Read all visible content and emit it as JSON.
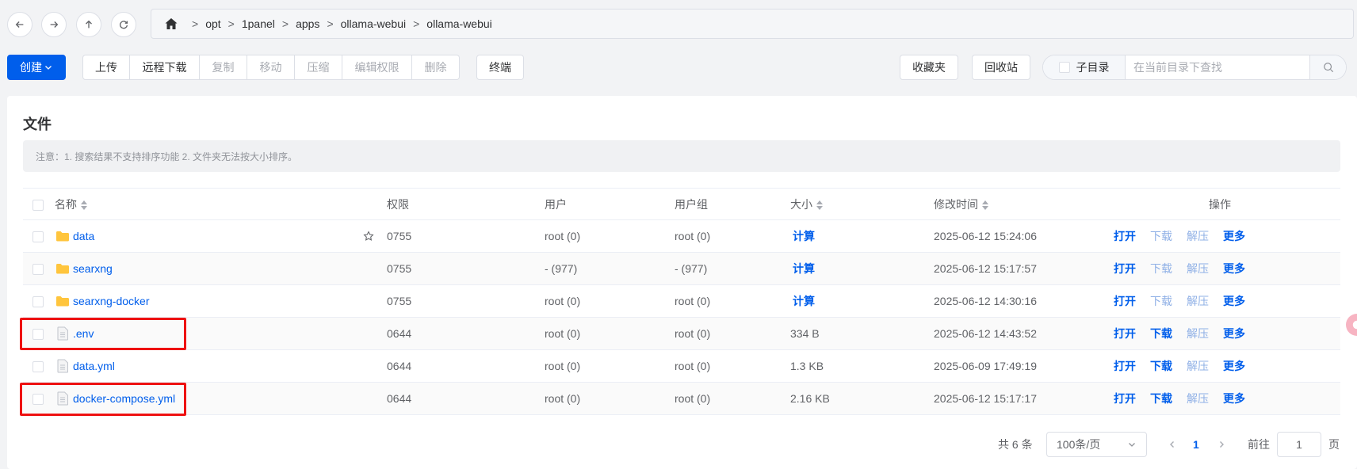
{
  "nav": {
    "breadcrumb": [
      "opt",
      "1panel",
      "apps",
      "ollama-webui",
      "ollama-webui"
    ],
    "separator": ">"
  },
  "toolbar": {
    "create_label": "创建",
    "group_buttons": [
      {
        "label": "上传",
        "disabled": false
      },
      {
        "label": "远程下载",
        "disabled": false
      },
      {
        "label": "复制",
        "disabled": true
      },
      {
        "label": "移动",
        "disabled": true
      },
      {
        "label": "压缩",
        "disabled": true
      },
      {
        "label": "编辑权限",
        "disabled": true
      },
      {
        "label": "删除",
        "disabled": true
      }
    ],
    "terminal_label": "终端",
    "favorites_label": "收藏夹",
    "recycle_label": "回收站",
    "subdir_label": "子目录",
    "search_placeholder": "在当前目录下查找"
  },
  "card": {
    "title": "文件",
    "notice": "注意：1. 搜索结果不支持排序功能 2. 文件夹无法按大小排序。"
  },
  "table": {
    "headers": {
      "name": "名称",
      "perm": "权限",
      "user": "用户",
      "group": "用户组",
      "size": "大小",
      "mtime": "修改时间",
      "ops": "操作"
    },
    "rows": [
      {
        "name": "data",
        "type": "folder",
        "perm": "0755",
        "user": "root (0)",
        "group": "root (0)",
        "size": "计算",
        "size_is_action": true,
        "mtime": "2025-06-12 15:24:06",
        "download_enabled": false
      },
      {
        "name": "searxng",
        "type": "folder",
        "perm": "0755",
        "user": "- (977)",
        "group": "- (977)",
        "size": "计算",
        "size_is_action": true,
        "mtime": "2025-06-12 15:17:57",
        "download_enabled": false
      },
      {
        "name": "searxng-docker",
        "type": "folder",
        "perm": "0755",
        "user": "root (0)",
        "group": "root (0)",
        "size": "计算",
        "size_is_action": true,
        "mtime": "2025-06-12 14:30:16",
        "download_enabled": false
      },
      {
        "name": ".env",
        "type": "file",
        "perm": "0644",
        "user": "root (0)",
        "group": "root (0)",
        "size": "334 B",
        "size_is_action": false,
        "mtime": "2025-06-12 14:43:52",
        "download_enabled": true
      },
      {
        "name": "data.yml",
        "type": "file",
        "perm": "0644",
        "user": "root (0)",
        "group": "root (0)",
        "size": "1.3 KB",
        "size_is_action": false,
        "mtime": "2025-06-09 17:49:19",
        "download_enabled": true
      },
      {
        "name": "docker-compose.yml",
        "type": "file",
        "perm": "0644",
        "user": "root (0)",
        "group": "root (0)",
        "size": "2.16 KB",
        "size_is_action": false,
        "mtime": "2025-06-12 15:17:17",
        "download_enabled": true
      }
    ],
    "op_labels": {
      "open": "打开",
      "download": "下载",
      "extract": "解压",
      "more": "更多"
    }
  },
  "pagination": {
    "total": "共 6 条",
    "page_size": "100条/页",
    "current_page": "1",
    "goto_label": "前往",
    "goto_value": "1",
    "page_suffix": "页"
  },
  "colors": {
    "primary": "#005eeb",
    "highlight": "#ee1111",
    "folder": "#ffc53d"
  }
}
